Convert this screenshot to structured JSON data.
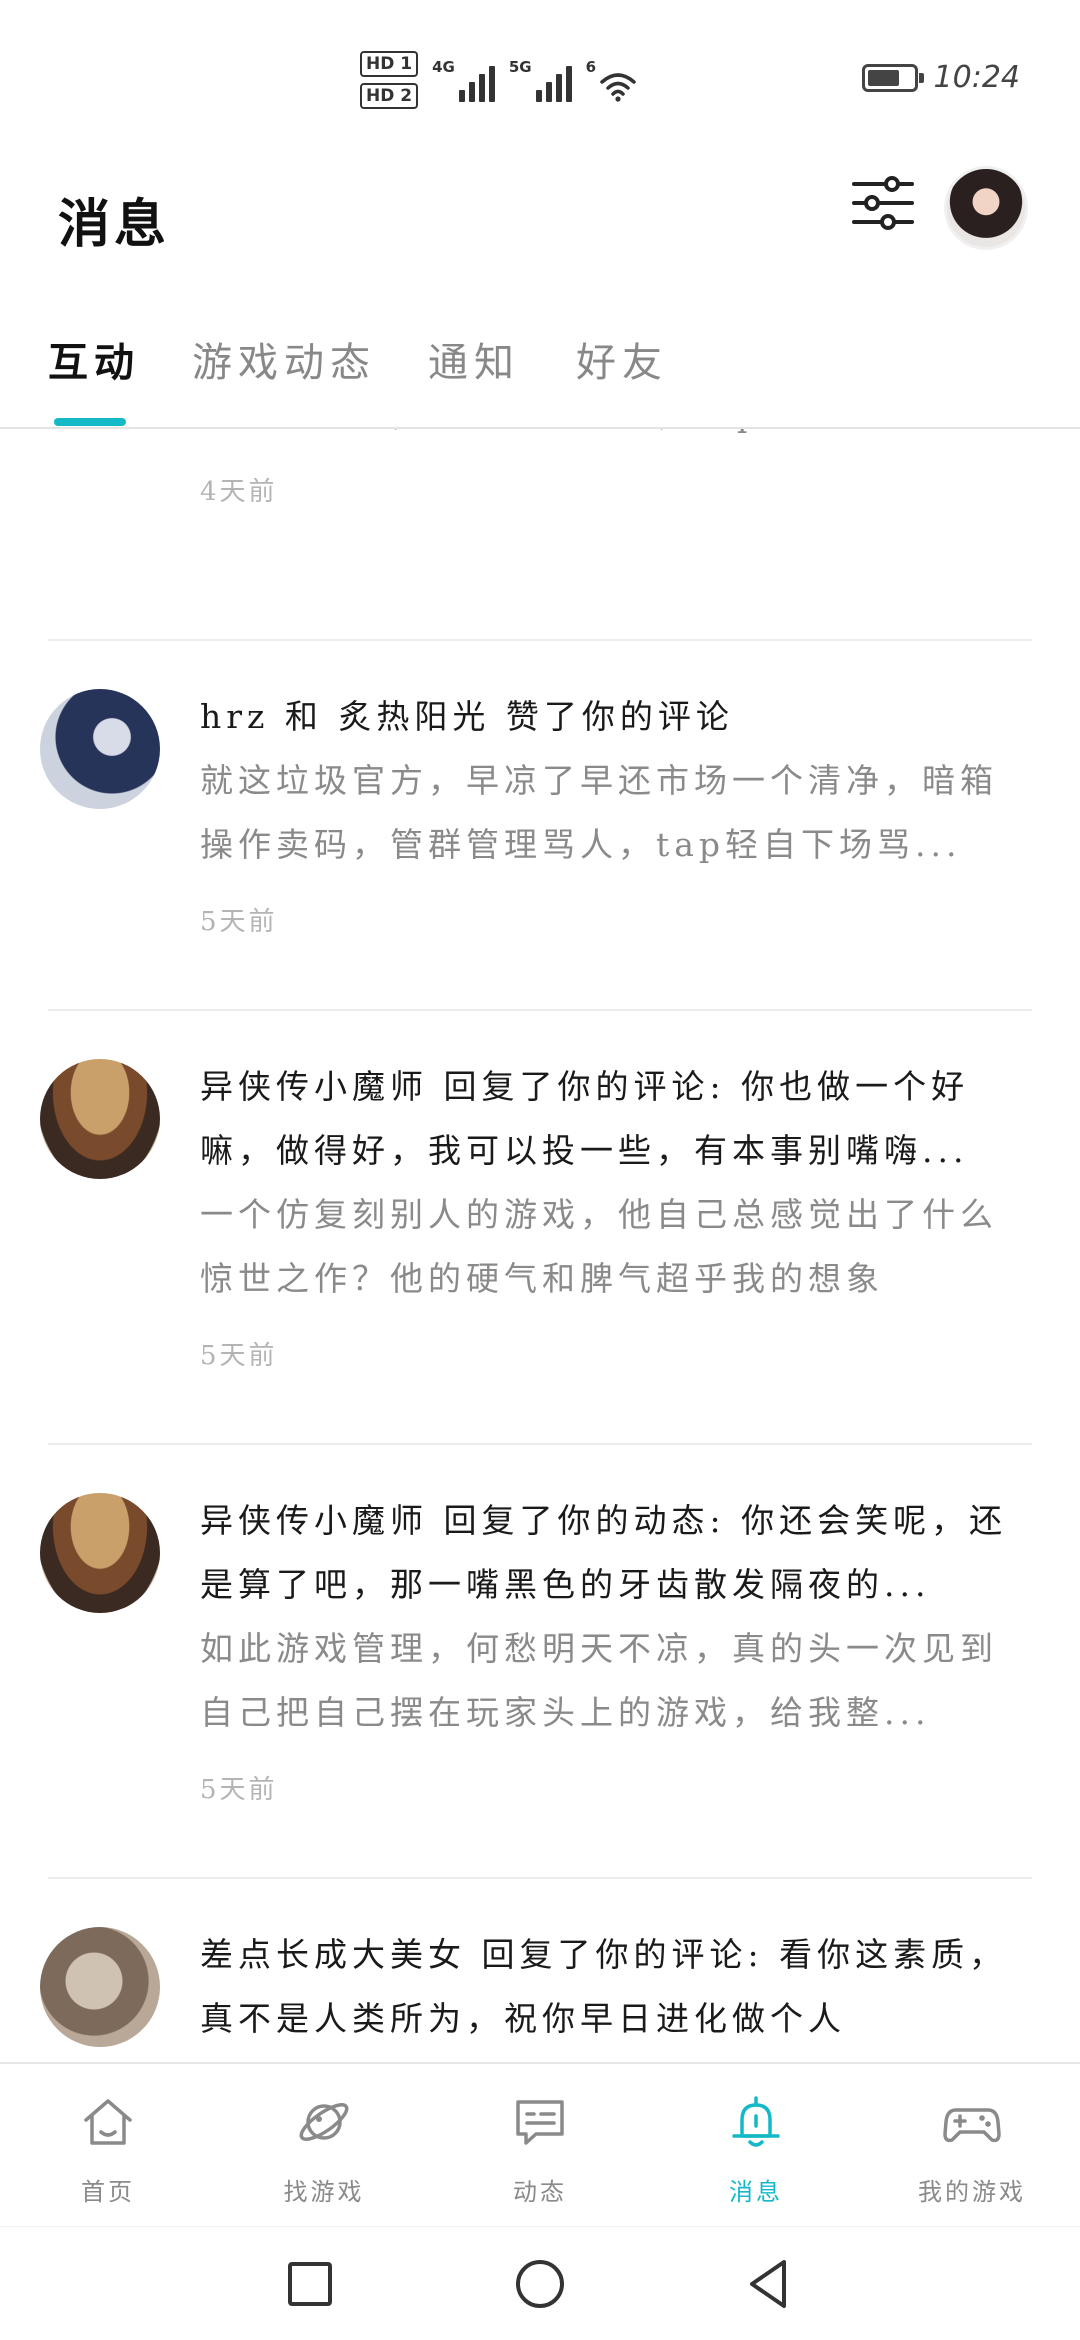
{
  "status_bar": {
    "hd1": "HD 1",
    "hd2": "HD 2",
    "net1": "4G",
    "net2": "5G",
    "wifi": "6",
    "time": "10:24"
  },
  "header": {
    "title": "消息"
  },
  "tabs": [
    {
      "label": "互动",
      "active": true
    },
    {
      "label": "游戏动态",
      "active": false
    },
    {
      "label": "通知",
      "active": false
    },
    {
      "label": "好友",
      "active": false
    }
  ],
  "feed": [
    {
      "excerpt": "箱操作卖码，管群管理骂人，tap轻自下场骂...",
      "time": "4天前"
    },
    {
      "headline": "hrz 和 炙热阳光 赞了你的评论",
      "excerpt": "就这垃圾官方，早凉了早还市场一个清净，暗箱操作卖码，管群管理骂人，tap轻自下场骂...",
      "time": "5天前"
    },
    {
      "headline": "异侠传小魔师 回复了你的评论: 你也做一个好嘛，做得好，我可以投一些，有本事别嘴嗨...",
      "excerpt": "一个仿复刻别人的游戏，他自己总感觉出了什么惊世之作？他的硬气和脾气超乎我的想象",
      "time": "5天前"
    },
    {
      "headline": "异侠传小魔师 回复了你的动态: 你还会笑呢，还是算了吧，那一嘴黑色的牙齿散发隔夜的...",
      "excerpt": "如此游戏管理，何愁明天不凉，真的头一次见到自己把自己摆在玩家头上的游戏，给我整...",
      "time": "5天前"
    },
    {
      "headline": "差点长成大美女 回复了你的评论: 看你这素质，真不是人类所为，祝你早日进化做个人"
    }
  ],
  "bottom_nav": [
    {
      "label": "首页",
      "icon": "home-icon",
      "active": false
    },
    {
      "label": "找游戏",
      "icon": "planet-icon",
      "active": false
    },
    {
      "label": "动态",
      "icon": "chat-bubble-icon",
      "active": false
    },
    {
      "label": "消息",
      "icon": "bell-icon",
      "active": true
    },
    {
      "label": "我的游戏",
      "icon": "gamepad-icon",
      "active": false
    }
  ],
  "colors": {
    "accent": "#14b9c8",
    "text_primary": "#1a1a1a",
    "text_secondary": "#8a8a8a",
    "text_time": "#b4b4b4"
  }
}
